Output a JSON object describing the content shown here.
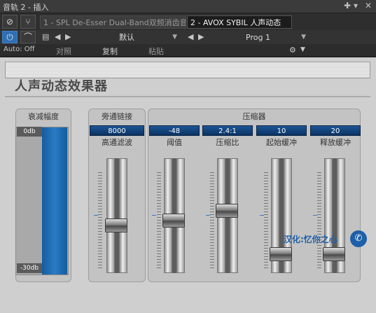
{
  "titlebar": {
    "title": "音轨 2 - 插入",
    "pin_icon": "pin-icon",
    "expand_icon": "expand-icon",
    "close_icon": "close-icon"
  },
  "tabs": [
    {
      "label": "1 - SPL De-Esser Dual-Band双频消齿音"
    },
    {
      "label": "2 - AVOX SYBIL 人声动态"
    }
  ],
  "toolbar": {
    "power_icon": "power-icon",
    "route_icon": "routing-icon",
    "auto_label": "Auto: Off",
    "preset_value": "默认",
    "program_value": "Prog 1",
    "compare_label": "对照",
    "copy_label": "复制",
    "paste_label": "粘贴"
  },
  "plugin": {
    "title": "人声动态效果器",
    "meter": {
      "title": "衰减幅度",
      "top_label": "0db",
      "bottom_label": "-30db"
    },
    "sidechain": {
      "title": "旁通链接",
      "value": "8000",
      "label": "高通滤波",
      "knob_level": 0.4
    },
    "compressor": {
      "title": "压缩器",
      "controls": [
        {
          "value": "-48",
          "label": "阈值",
          "knob_level": 0.45
        },
        {
          "value": "2.4:1",
          "label": "压缩比",
          "knob_level": 0.55
        },
        {
          "value": "10",
          "label": "起始缓冲",
          "knob_level": 0.12
        },
        {
          "value": "20",
          "label": "释放缓冲",
          "knob_level": 0.12
        }
      ]
    },
    "credit": "汉化:忆你之心",
    "colors": {
      "accent": "#1d5fa8",
      "value_box": "#1c5596"
    }
  }
}
